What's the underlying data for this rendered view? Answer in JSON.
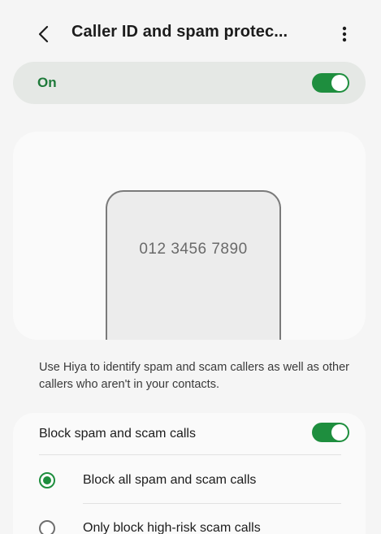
{
  "header": {
    "title": "Caller ID and spam protec...",
    "back_icon": "chevron-left-icon",
    "more_icon": "more-vertical-icon"
  },
  "master_toggle": {
    "label": "On",
    "state": "on"
  },
  "illustration": {
    "phone_number": "012 3456 7890"
  },
  "description": "Use Hiya to identify spam and scam callers as well as other callers who aren't in your contacts.",
  "block_spam": {
    "label": "Block spam and scam calls",
    "state": "on"
  },
  "block_options": [
    {
      "label": "Block all spam and scam calls",
      "selected": true
    },
    {
      "label": "Only block high-risk scam calls",
      "selected": false
    }
  ],
  "colors": {
    "accent": "#1e8e3e",
    "master_label": "#1e7a3a",
    "master_card": "#e5e8e5",
    "background": "#f5f5f5"
  }
}
